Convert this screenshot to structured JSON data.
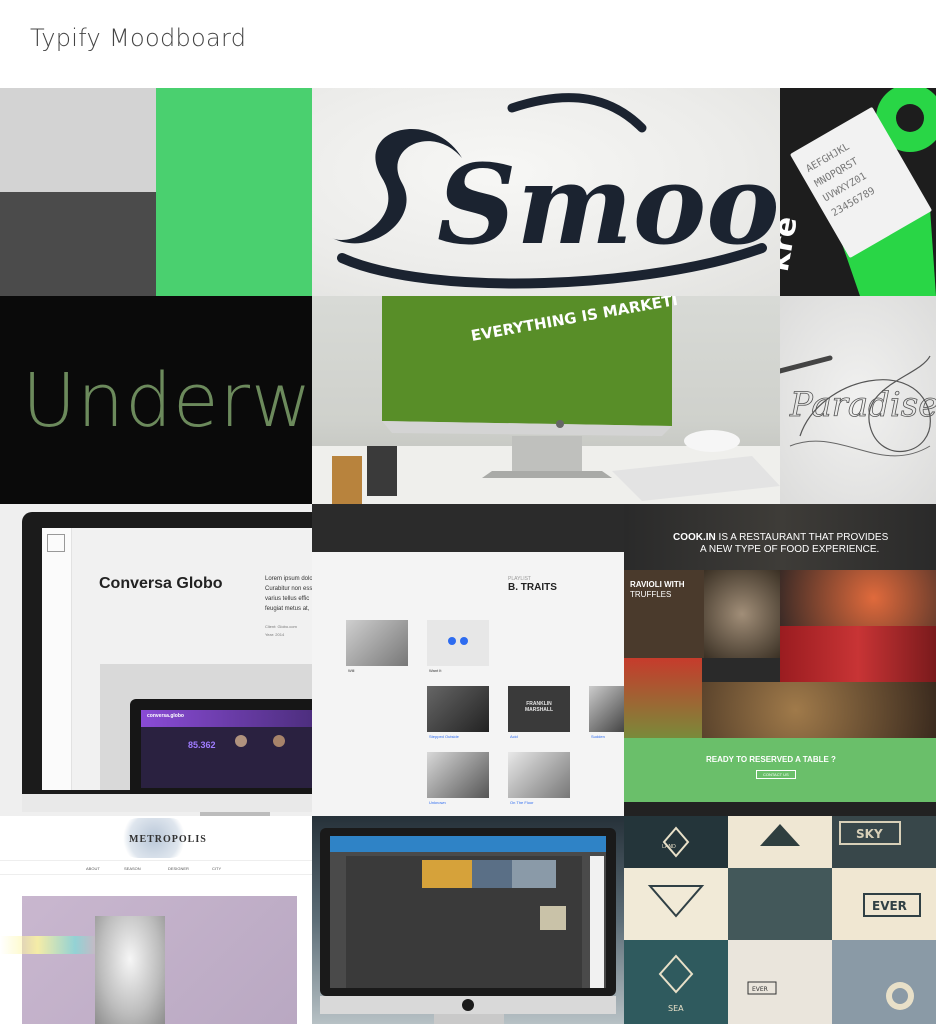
{
  "app": {
    "title": "Typify Moodboard"
  },
  "tiles": {
    "swatch_light": {
      "color": "#d3d3d3"
    },
    "swatch_dark": {
      "color": "#4b4b4b"
    },
    "swatch_green": {
      "color": "#4ad06f"
    },
    "smooth": {
      "text": "Smooth"
    },
    "poster": {
      "text": "kre"
    },
    "underwood": {
      "text": "Underwo"
    },
    "desk": {
      "headline": "EVERYTHING IS MARKETI"
    },
    "paradise": {
      "text": "Paradise"
    },
    "laptop": {
      "heading": "Conversa Globo",
      "body": "Lorem ipsum dolor\nCurabitur non esse\nvarius tellus effic\nfeugiat metus at,",
      "client": "Client: Globo.com",
      "year": "Year: 2014",
      "screen_title": "conversa.globo",
      "screen_number": "85.362"
    },
    "music": {
      "header": "B. TRAITS",
      "subheader": "PLAYLIST",
      "items": [
        "Will",
        "Want It",
        "Stepped Outside",
        "Acid",
        "Sudden",
        "Unknown",
        "On The Floor"
      ],
      "logo": "FRANKLIN MARSHALL"
    },
    "cook": {
      "brand": "COOK.IN",
      "headline_rest": " IS A RESTAURANT THAT PROVIDES",
      "headline2": "A NEW TYPE OF FOOD EXPERIENCE.",
      "card_title": "RAVIOLI WITH",
      "card_sub": "TRUFFLES",
      "cta": "READY TO RESERVED A TABLE ?",
      "cta_button": "CONTACT US"
    },
    "metro": {
      "logo": "METROPOLIS",
      "nav": [
        "ABOUT",
        "SEASON",
        "DESIGNER",
        "CITY"
      ]
    },
    "imac": {
      "label": "imac app mockup"
    },
    "sky": {
      "words": [
        "SKY",
        "EVER",
        "LAND",
        "SEA",
        "EVER"
      ]
    }
  }
}
